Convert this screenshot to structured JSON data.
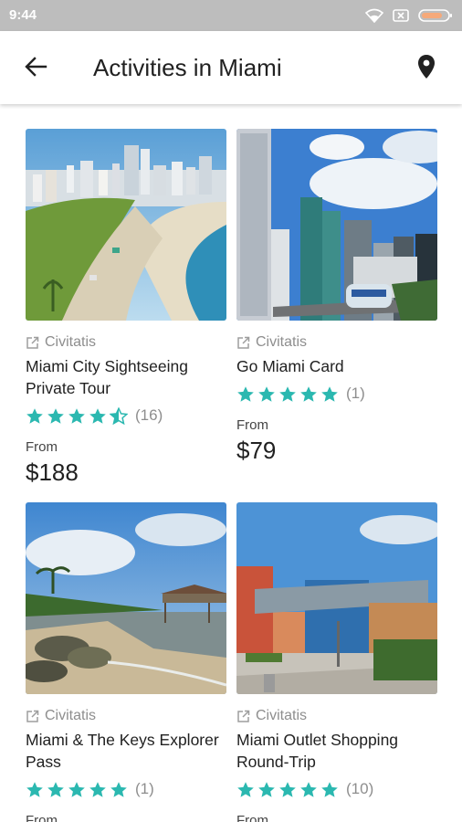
{
  "status_bar": {
    "time": "9:44"
  },
  "app_bar": {
    "title": "Activities in Miami"
  },
  "colors": {
    "star": "#2bb8b0",
    "status_bar": "#bdbdbd"
  },
  "activities": [
    {
      "provider": "Civitatis",
      "title": "Miami City Sightseeing Private Tour",
      "rating": 4.5,
      "reviews": "(16)",
      "from_label": "From",
      "price": "$188",
      "image": "miami-beach-skyline"
    },
    {
      "provider": "Civitatis",
      "title": "Go Miami Card",
      "rating": 5,
      "reviews": "(1)",
      "from_label": "From",
      "price": "$79",
      "image": "downtown-metromover"
    },
    {
      "provider": "Civitatis",
      "title": "Miami & The Keys Explorer Pass",
      "rating": 5,
      "reviews": "(1)",
      "from_label": "From",
      "price": "",
      "image": "keys-pier-coast"
    },
    {
      "provider": "Civitatis",
      "title": "Miami Outlet Shopping Round-Trip",
      "rating": 5,
      "reviews": "(10)",
      "from_label": "From",
      "price": "",
      "image": "dolphin-mall"
    }
  ]
}
